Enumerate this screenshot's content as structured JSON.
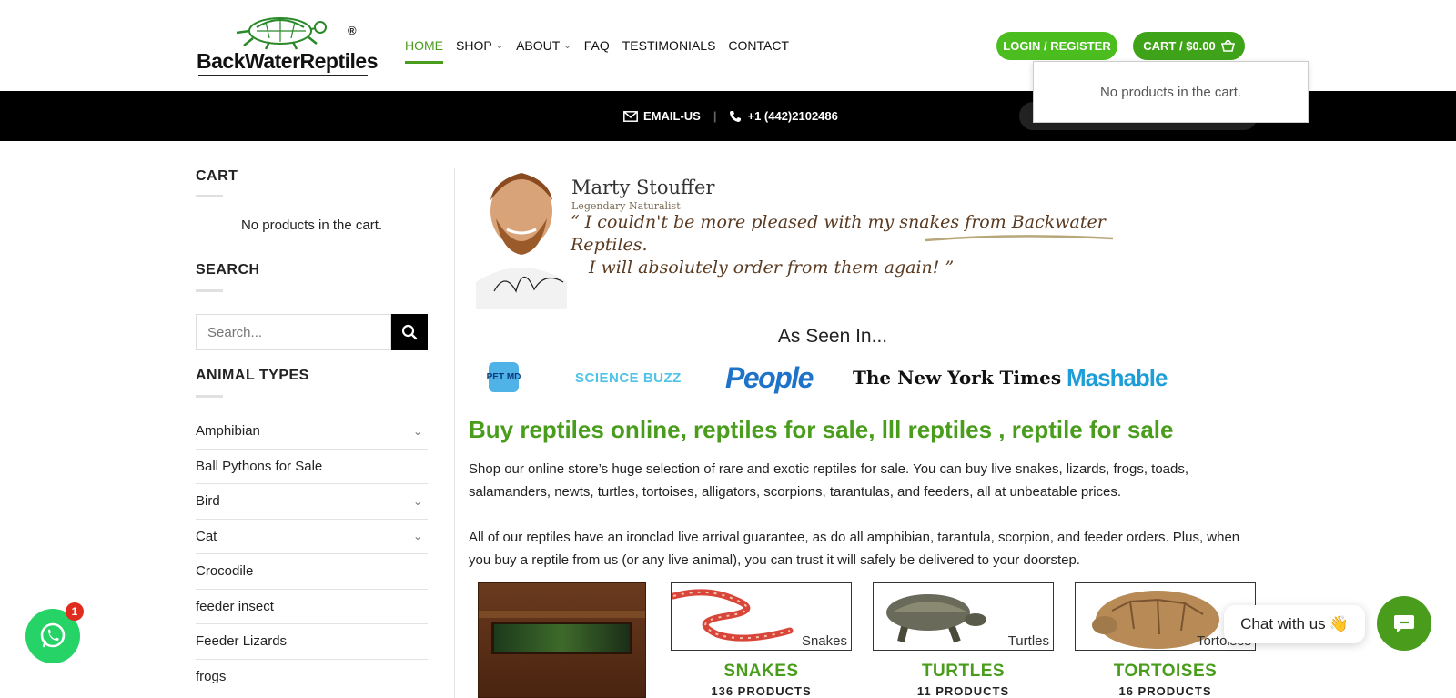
{
  "header": {
    "logo_text": "BackWaterReptiles",
    "logo_reg": "®",
    "nav": [
      {
        "label": "HOME",
        "active": true,
        "dropdown": false
      },
      {
        "label": "SHOP",
        "active": false,
        "dropdown": true
      },
      {
        "label": "ABOUT",
        "active": false,
        "dropdown": true
      },
      {
        "label": "FAQ",
        "active": false,
        "dropdown": false
      },
      {
        "label": "TESTIMONIALS",
        "active": false,
        "dropdown": false
      },
      {
        "label": "CONTACT",
        "active": false,
        "dropdown": false
      }
    ],
    "login_label": "LOGIN / REGISTER",
    "cart_label": "CART / $0.00",
    "cart_popup_text": "No products in the cart."
  },
  "topbar": {
    "email_label": "EMAIL-US",
    "separator": "|",
    "phone_label": "+1 (442)2102486"
  },
  "sidebar": {
    "cart_title": "CART",
    "cart_empty": "No products in the cart.",
    "search_title": "SEARCH",
    "search_placeholder": "Search...",
    "animal_types_title": "ANIMAL TYPES",
    "categories": [
      {
        "label": "Amphibian",
        "expandable": true
      },
      {
        "label": "Ball Pythons for Sale",
        "expandable": false
      },
      {
        "label": "Bird",
        "expandable": true
      },
      {
        "label": "Cat",
        "expandable": true
      },
      {
        "label": "Crocodile",
        "expandable": false
      },
      {
        "label": "feeder insect",
        "expandable": false
      },
      {
        "label": "Feeder Lizards",
        "expandable": false
      },
      {
        "label": "frogs",
        "expandable": false
      }
    ]
  },
  "main": {
    "testimonial": {
      "name": "Marty Stouffer",
      "role": "Legendary Naturalist",
      "quote_line1": "“ I couldn't be more pleased with my snakes from Backwater Reptiles.",
      "quote_line2": "I will absolutely order from them again! ”"
    },
    "seen_in_title": "As Seen In...",
    "press_logos": {
      "petmd": "PET MD",
      "science_buzz": "SCIENCE BUZZ",
      "people": "People",
      "nyt": "The New York Times",
      "mashable": "Mashable"
    },
    "heading": "Buy reptiles online, reptiles for sale, lll reptiles , reptile for sale",
    "paragraph1": "Shop our online store’s huge selection of rare and exotic reptiles for sale. You can buy live snakes, lizards, frogs, toads, salamanders, newts, turtles, tortoises, alligators, scorpions, tarantulas, and feeders, all at unbeatable prices.",
    "paragraph2": "All of our reptiles have an ironclad live arrival guarantee, as do all amphibian, tarantula, scorpion, and feeder orders. Plus, when you buy a reptile from us (or any live animal), you can trust it will safely be delivered to your doorstep.",
    "categories": [
      {
        "image_label": "Snakes",
        "title": "SNAKES",
        "count": "136 PRODUCTS"
      },
      {
        "image_label": "Turtles",
        "title": "TURTLES",
        "count": "11 PRODUCTS"
      },
      {
        "image_label": "Tortoises",
        "title": "TORTOISES",
        "count": "16 PRODUCTS"
      }
    ]
  },
  "floating": {
    "whatsapp_badge": "1",
    "chat_label": "Chat with us",
    "chat_emoji": "👋"
  },
  "colors": {
    "brand_green": "#4a9d1c",
    "button_green": "#4bbd1f",
    "whatsapp_green": "#25d366",
    "topbar_bg": "#000000"
  }
}
